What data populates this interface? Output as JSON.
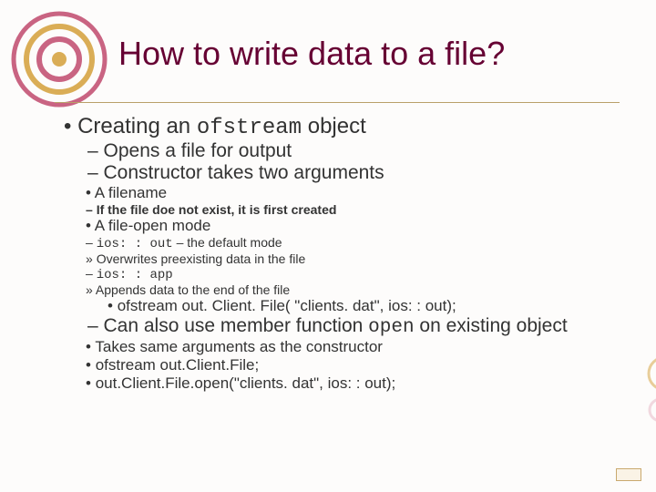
{
  "title": "How to write data to a file?",
  "bullets": {
    "l1_1": "Creating an ",
    "l1_1_code": "ofstream",
    "l1_1_tail": " object",
    "l2_1": "Opens a file for output",
    "l2_2": "Constructor takes two arguments",
    "l3_1": "A filename",
    "l4_1": "If the file doe not exist, it is first created",
    "l3_2": "A file-open mode",
    "l4_2_code": "ios: : out",
    "l4_2_tail": " – the default mode",
    "l5_1": "Overwrites preexisting data in the file",
    "l4_3_code": "ios: : app",
    "l5_2": "Appends data to the end of the file",
    "l3_3": "ofstream out. Client. File( \"clients. dat\", ios: : out);",
    "l2_3a": "Can also use member function ",
    "l2_3_code": "open",
    "l2_3b": " on existing object",
    "l3_4": "Takes same arguments as the constructor",
    "l3_5": "ofstream out.Client.File;",
    "l3_6": "out.Client.File.open(\"clients. dat\", ios: : out);"
  }
}
